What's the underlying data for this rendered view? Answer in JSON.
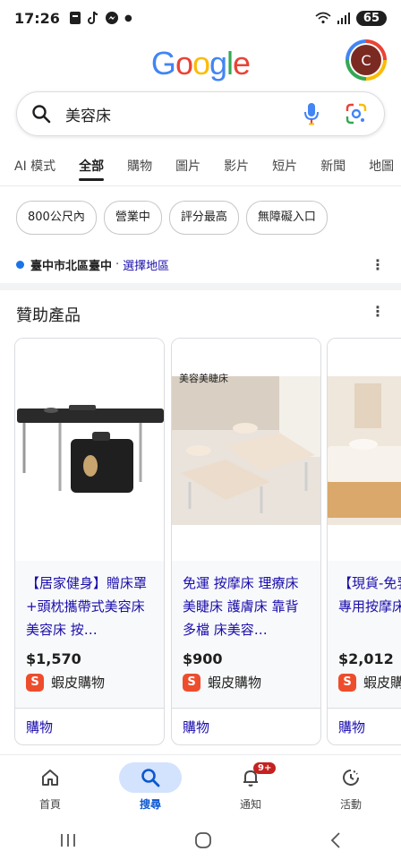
{
  "status_bar": {
    "time": "17:26",
    "battery": "65"
  },
  "header": {
    "logo_letters": [
      "G",
      "o",
      "o",
      "g",
      "l",
      "e"
    ],
    "logo_colors": [
      "#4285f4",
      "#ea4335",
      "#fbbc05",
      "#4285f4",
      "#34a853",
      "#ea4335"
    ],
    "avatar_letter": "C"
  },
  "search": {
    "query": "美容床"
  },
  "tabs": [
    {
      "label": "AI 模式"
    },
    {
      "label": "全部"
    },
    {
      "label": "購物"
    },
    {
      "label": "圖片"
    },
    {
      "label": "影片"
    },
    {
      "label": "短片"
    },
    {
      "label": "新聞"
    },
    {
      "label": "地圖"
    }
  ],
  "chips": [
    {
      "label": "800公尺內"
    },
    {
      "label": "營業中"
    },
    {
      "label": "評分最高"
    },
    {
      "label": "無障礙入口"
    }
  ],
  "location": {
    "place": "臺中市北區臺中",
    "separator": "·",
    "link": "選擇地區"
  },
  "sponsored": {
    "title": "贊助產品",
    "cards": [
      {
        "title": "【居家健身】贈床罩+頭枕攜帶式美容床 美容床 按…",
        "price": "$1,570",
        "store": "蝦皮購物",
        "cta": "購物"
      },
      {
        "title": "免運 按摩床 理療床 美睫床 護膚床 靠背多檔 床美容…",
        "price": "$900",
        "store": "蝦皮購物",
        "cta": "購物",
        "image_label": "美容美睫床"
      },
      {
        "title": "【現貨-免乳膠美容床專用按摩床",
        "price": "$2,012",
        "store": "蝦皮購物",
        "cta": "購物"
      }
    ]
  },
  "bottom_nav": [
    {
      "label": "首頁",
      "icon": "home-icon"
    },
    {
      "label": "搜尋",
      "icon": "search-icon"
    },
    {
      "label": "通知",
      "icon": "bell-icon",
      "badge": "9+"
    },
    {
      "label": "活動",
      "icon": "activity-icon"
    }
  ]
}
